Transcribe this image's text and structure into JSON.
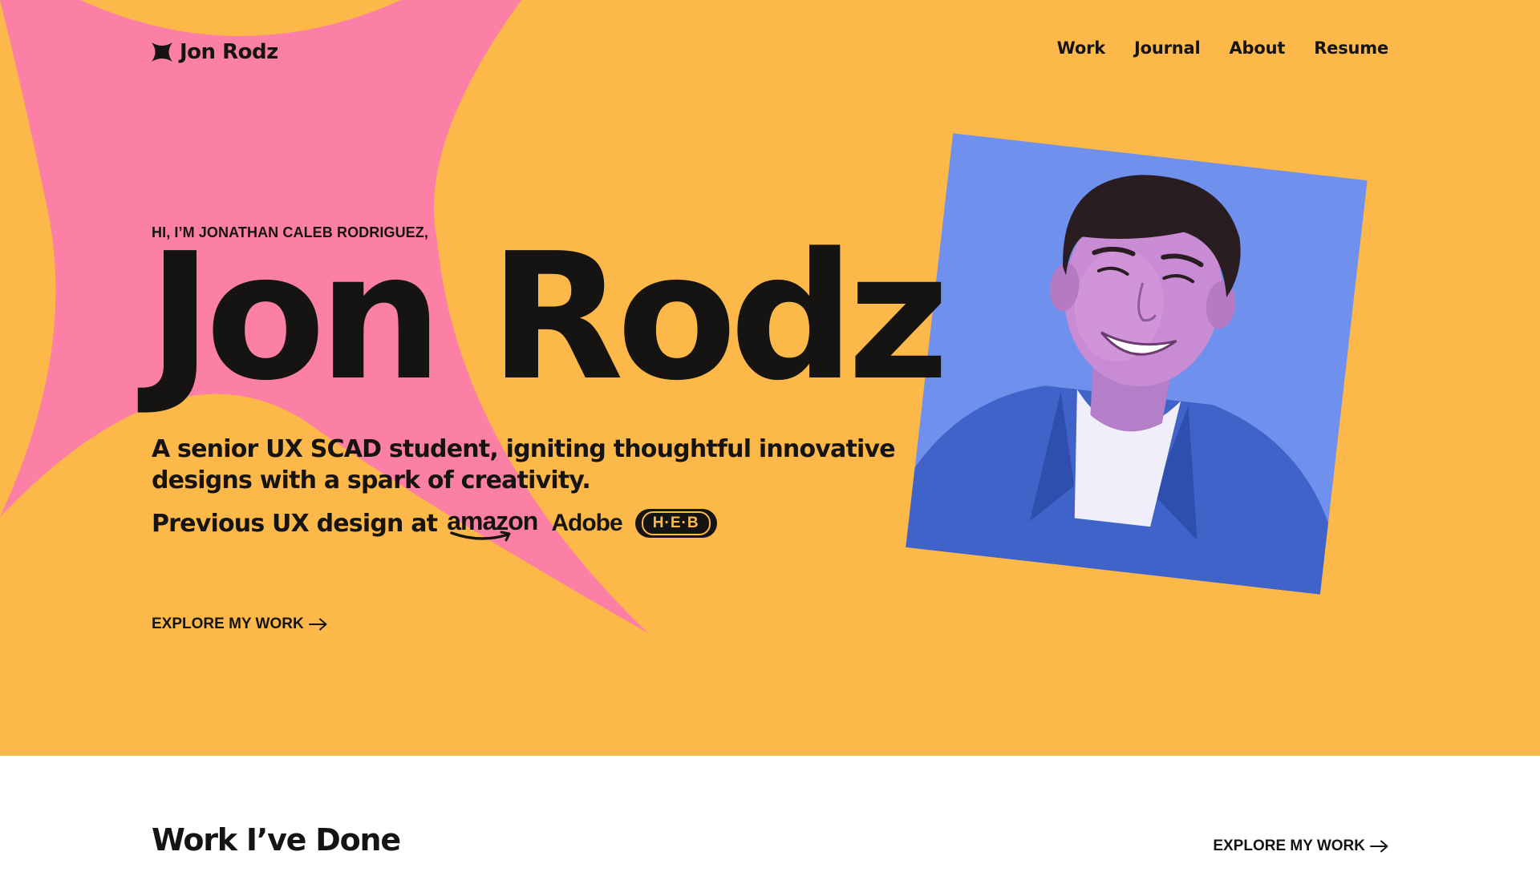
{
  "colors": {
    "hero_bg": "#fdb84a",
    "burst": "#fc7fa6",
    "ink": "#161412",
    "photo_bg": "#6f90ec",
    "page_bg": "#ffffff"
  },
  "brand": {
    "icon": "four-point-star-icon",
    "name": "Jon Rodz"
  },
  "nav": {
    "work": "Work",
    "journal": "Journal",
    "about": "About",
    "resume": "Resume"
  },
  "hero": {
    "eyebrow": "HI, I’M JONATHAN CALEB RODRIGUEZ,",
    "title": "Jon Rodz",
    "tagline": "A senior UX SCAD student, igniting thoughtful innovative designs with a spark of creativity.",
    "previous_prefix": "Previous UX design at",
    "logos": {
      "amazon": "amazon",
      "adobe": "Adobe",
      "heb": "H·E·B"
    },
    "cta": "EXPLORE MY WORK",
    "cta_icon": "arrow-right-icon",
    "portrait": "portrait-photo"
  },
  "work_section": {
    "heading": "Work I’ve Done",
    "cta": "EXPLORE MY WORK",
    "cta_icon": "arrow-right-icon"
  }
}
